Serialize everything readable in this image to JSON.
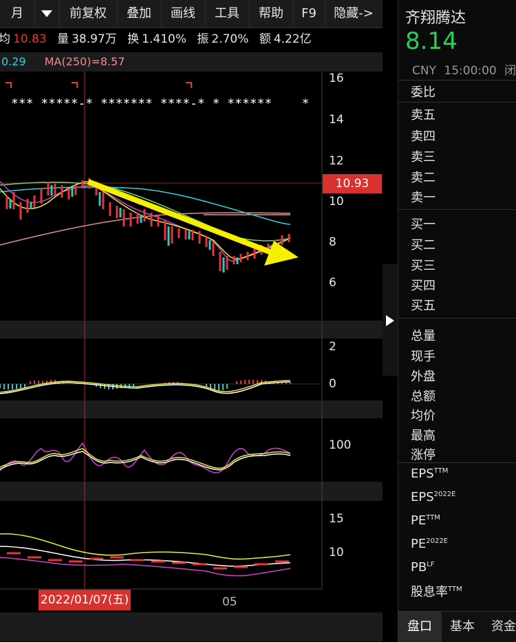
{
  "toolbar": {
    "items": [
      "月",
      "",
      "前复权",
      "叠加",
      "画线",
      "工具",
      "帮助",
      "F9",
      "隐藏->"
    ]
  },
  "info": {
    "avg_label": "均",
    "avg_value": "10.83",
    "vol_label": "量",
    "vol_value": "38.97万",
    "turn_label": "换",
    "turn_value": "1.410%",
    "amp_label": "振",
    "amp_value": "2.70%",
    "amt_label": "额",
    "amt_value": "4.22亿"
  },
  "ma": {
    "partial": "0.29",
    "ma250": "MA(250)=8.57"
  },
  "price_axis": {
    "ticks": [
      "16",
      "14",
      "12",
      "10",
      "8",
      "6"
    ],
    "current_price": "10.93"
  },
  "macd_axis": {
    "ticks": [
      "2",
      "0"
    ]
  },
  "kdj_axis": {
    "ticks": [
      "100"
    ]
  },
  "boll_axis": {
    "ticks": [
      "15",
      "10"
    ]
  },
  "time_axis": {
    "cursor_date": "2022/01/07(五)",
    "month_label": "05"
  },
  "stock": {
    "name": "齐翔腾达",
    "price": "8.14",
    "currency": "CNY",
    "time": "15:00:00",
    "status": "闭"
  },
  "orderbook": {
    "ratio_label": "委比",
    "sell": [
      "卖五",
      "卖四",
      "卖三",
      "卖二",
      "卖一"
    ],
    "buy": [
      "买一",
      "买二",
      "买三",
      "买四",
      "买五"
    ]
  },
  "stats": [
    "总量",
    "现手",
    "外盘",
    "总额",
    "均价",
    "最高",
    "涨停"
  ],
  "fundamentals": [
    {
      "label": "EPS",
      "sup": "TTM"
    },
    {
      "label": "EPS",
      "sup": "2022E"
    },
    {
      "label": "PE",
      "sup": "TTM"
    },
    {
      "label": "PE",
      "sup": "2022E"
    },
    {
      "label": "PB",
      "sup": "LF"
    },
    {
      "label": "股息率",
      "sup": "TTM"
    }
  ],
  "bottom_tabs": [
    "盘口",
    "基本",
    "资金"
  ],
  "colors": {
    "up": "#e8353a",
    "down": "#2fc8c8",
    "accent_price": "#2ecc5f",
    "arrow": "#f5f000"
  }
}
